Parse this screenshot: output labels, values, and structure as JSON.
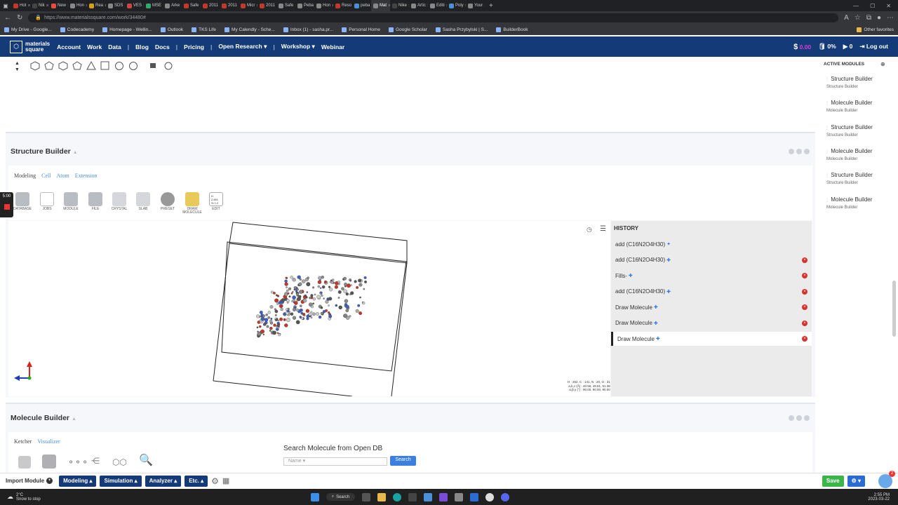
{
  "browser": {
    "tabs": [
      "Hot",
      "Nik",
      "New",
      "Hon",
      "Rea",
      "SDS",
      "VES",
      "MSE",
      "Arke",
      "Safe",
      "2011",
      "2011",
      "Micr",
      "2011",
      "Safe",
      "Peba",
      "Hon",
      "Reso",
      "peba",
      "Mat",
      "Nike",
      "Artic",
      "Editi",
      "Poly",
      "Your"
    ],
    "tab_colors": [
      "#c0392b",
      "#444",
      "#e74c3c",
      "#888",
      "#d4a017",
      "#888",
      "#c44",
      "#3a6",
      "#888",
      "#c0392b",
      "#c0392b",
      "#c0392b",
      "#c0392b",
      "#c0392b",
      "#888",
      "#888",
      "#888",
      "#c0392b",
      "#4a90d9",
      "#888",
      "#444",
      "#888",
      "#888",
      "#4a90d9",
      "#888"
    ],
    "url": "https://www.materialssquare.com/work/34480#",
    "bookmarks": [
      "My Drive - Google...",
      "Codecademy",
      "Homepage - Wellin...",
      "Outlook",
      "TKS Life",
      "My Calendly - Sche...",
      "Inbox (1) - sasha.pr...",
      "Personal Home",
      "Google Scholar",
      "Sasha Przybylski | S...",
      "BuilderBook"
    ],
    "other_favorites": "Other favorites"
  },
  "nav": {
    "logo_line1": "materials",
    "logo_line2": "square",
    "links": [
      "Account",
      "Work",
      "Data",
      "Blog",
      "Docs",
      "Pricing",
      "Open Research",
      "Workshop",
      "Webinar"
    ],
    "credits": "0.00",
    "storage": "0%",
    "jobs": "0",
    "logout": "Log out"
  },
  "structure_builder": {
    "title": "Structure Builder",
    "tabs": [
      "Modeling",
      "Cell",
      "Atom",
      "Extension"
    ],
    "tools": [
      "DATABASE",
      "JOBS",
      "MODULE",
      "FILE",
      "CRYSTAL",
      "SLAB",
      "PRESET",
      "DRAW MOLECULE",
      "EDIT"
    ],
    "edit_values": [
      "H",
      "2.891",
      "Si",
      "1.2"
    ],
    "history_title": "HISTORY",
    "history": [
      {
        "label": "add (C16N2O4H30)",
        "deletable": false
      },
      {
        "label": "add (C16N2O4H30)",
        "deletable": true
      },
      {
        "label": "Fills-",
        "deletable": true
      },
      {
        "label": "add (C16N2O4H30)",
        "deletable": true
      },
      {
        "label": "Draw Molecule",
        "deletable": true
      },
      {
        "label": "Draw Molecule",
        "deletable": true
      },
      {
        "label": "Draw Molecule",
        "deletable": true
      }
    ],
    "info_line1": "H : 262, C : 141, N : 20, O : 31",
    "info_line2": "a,b,c (Å) : 40.56, 49.81, 51.38",
    "info_line3": "α,β,γ (°) : 90.00, 90.00, 90.00"
  },
  "molecule_builder": {
    "title": "Molecule Builder",
    "tabs": [
      "Ketcher",
      "Visualizer"
    ],
    "search_title": "Search Molecule from Open DB",
    "search_field": "Name",
    "search_button": "Search"
  },
  "timer": "5:00",
  "sidebar": {
    "title": "ACTIVE MODULES",
    "items": [
      {
        "title": "Structure Builder",
        "sub": "Structure Builder"
      },
      {
        "title": "Molecule Builder",
        "sub": "Molecule Builder"
      },
      {
        "title": "Structure Builder",
        "sub": "Structure Builder"
      },
      {
        "title": "Molecule Builder",
        "sub": "Molecule Builder"
      },
      {
        "title": "Structure Builder",
        "sub": "Structure Builder"
      },
      {
        "title": "Molecule Builder",
        "sub": "Molecule Builder"
      }
    ]
  },
  "bottom": {
    "import": "Import Module",
    "buttons": [
      "Modeling",
      "Simulation",
      "Analyzer",
      "Etc."
    ],
    "save": "Save",
    "notif_count": "2"
  },
  "taskbar": {
    "weather_temp": "2°C",
    "weather_desc": "Snow to stop",
    "search": "Search",
    "time": "2:55 PM",
    "date": "2023-03-22"
  }
}
